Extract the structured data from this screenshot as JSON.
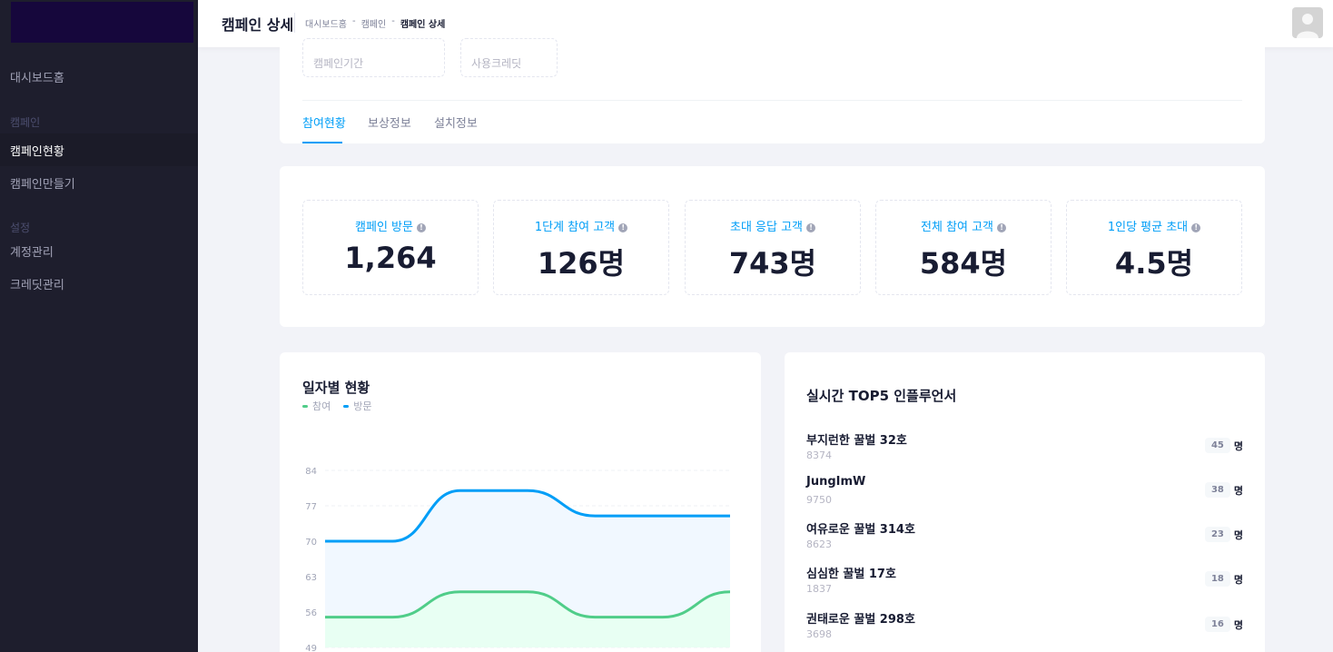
{
  "sidebar": {
    "items": {
      "home": "대시보드홈",
      "section_campaign": "캠페인",
      "campaign_status": "캠페인현황",
      "campaign_create": "캠페인만들기",
      "section_settings": "설정",
      "account": "계정관리",
      "credit": "크레딧관리"
    }
  },
  "header": {
    "title": "캠페인 상세",
    "breadcrumb": [
      "대시보드홈",
      "-",
      "캠페인",
      "-",
      "캠페인 상세"
    ]
  },
  "campaign_info": {
    "period_label": "캠페인기간",
    "credit_label": "사용크레딧"
  },
  "tabs": [
    "참여현황",
    "보상정보",
    "설치정보"
  ],
  "stats": [
    {
      "label": "캠페인 방문",
      "value": "1,264"
    },
    {
      "label": "1단계 참여 고객",
      "value": "126명"
    },
    {
      "label": "초대 응답 고객",
      "value": "743명"
    },
    {
      "label": "전체 참여 고객",
      "value": "584명"
    },
    {
      "label": "1인당 평균 초대",
      "value": "4.5명"
    }
  ],
  "daily": {
    "title": "일자별 현황"
  },
  "chart_data": {
    "type": "area",
    "title": "일자별 현황",
    "ylim": [
      49,
      84
    ],
    "yticks": [
      84,
      77,
      70,
      63,
      56,
      49
    ],
    "x": [
      0,
      1,
      2,
      3,
      4,
      5,
      6
    ],
    "series": [
      {
        "name": "참여",
        "color": "#50cd89",
        "values": [
          55,
          55,
          60,
          60,
          55,
          55,
          60
        ]
      },
      {
        "name": "방문",
        "color": "#009ef7",
        "values": [
          70,
          70,
          80,
          80,
          75,
          75,
          75
        ]
      }
    ],
    "grid": true,
    "legend": "top-left"
  },
  "top5": {
    "title": "실시간 TOP5 인플루언서",
    "unit": "명",
    "items": [
      {
        "name": "부지런한 꿀벌 32호",
        "id": "8374",
        "count": "45"
      },
      {
        "name": "JungImW",
        "id": "9750",
        "count": "38"
      },
      {
        "name": "여유로운 꿀벌 314호",
        "id": "8623",
        "count": "23"
      },
      {
        "name": "심심한 꿀벌 17호",
        "id": "1837",
        "count": "18"
      },
      {
        "name": "권태로운 꿀벌 298호",
        "id": "3698",
        "count": "16"
      }
    ]
  }
}
